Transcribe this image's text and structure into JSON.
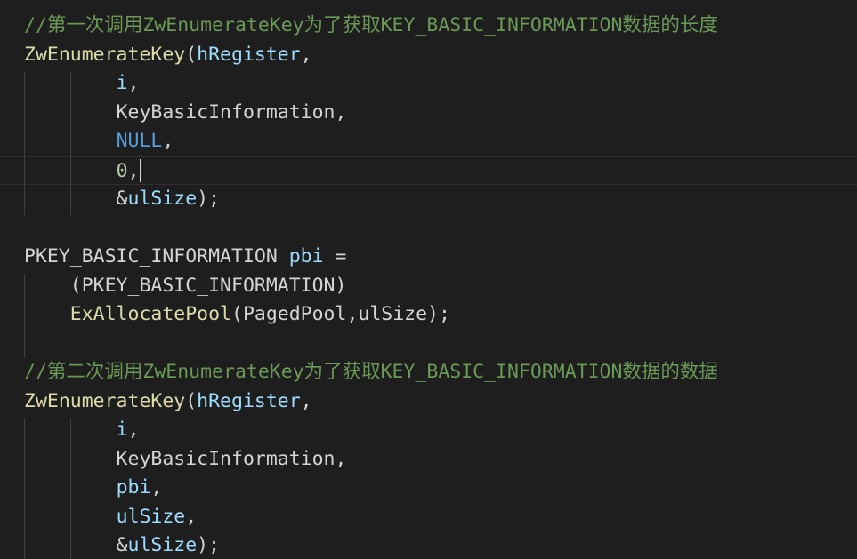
{
  "editor": {
    "colors": {
      "background": "#1e1e1e",
      "comment": "#6a9955",
      "function": "#dcdcaa",
      "variable": "#9cdcfe",
      "constant": "#569cd6",
      "default": "#d4d4d4",
      "number": "#b5cea8"
    },
    "lines": [
      [
        {
          "t": "comment",
          "v": "//第一次调用ZwEnumerateKey为了获取KEY_BASIC_INFORMATION数据的长度"
        }
      ],
      [
        {
          "t": "func",
          "v": "ZwEnumerateKey"
        },
        {
          "t": "plain",
          "v": "("
        },
        {
          "t": "var",
          "v": "hRegister"
        },
        {
          "t": "plain",
          "v": ","
        }
      ],
      [
        {
          "t": "plain",
          "v": "        "
        },
        {
          "t": "var",
          "v": "i"
        },
        {
          "t": "plain",
          "v": ","
        }
      ],
      [
        {
          "t": "plain",
          "v": "        KeyBasicInformation,"
        }
      ],
      [
        {
          "t": "plain",
          "v": "        "
        },
        {
          "t": "const",
          "v": "NULL"
        },
        {
          "t": "plain",
          "v": ","
        }
      ],
      [
        {
          "t": "plain",
          "v": "        "
        },
        {
          "t": "num",
          "v": "0"
        },
        {
          "t": "plain",
          "v": ","
        }
      ],
      [
        {
          "t": "plain",
          "v": "        &"
        },
        {
          "t": "var",
          "v": "ulSize"
        },
        {
          "t": "plain",
          "v": ");"
        }
      ],
      [],
      [
        {
          "t": "plain",
          "v": "PKEY_BASIC_INFORMATION "
        },
        {
          "t": "var",
          "v": "pbi"
        },
        {
          "t": "plain",
          "v": " ="
        }
      ],
      [
        {
          "t": "plain",
          "v": "    (PKEY_BASIC_INFORMATION)"
        }
      ],
      [
        {
          "t": "plain",
          "v": "    "
        },
        {
          "t": "func",
          "v": "ExAllocatePool"
        },
        {
          "t": "plain",
          "v": "(PagedPool,ulSize);"
        }
      ],
      [],
      [
        {
          "t": "comment",
          "v": "//第二次调用ZwEnumerateKey为了获取KEY_BASIC_INFORMATION数据的数据"
        }
      ],
      [
        {
          "t": "func",
          "v": "ZwEnumerateKey"
        },
        {
          "t": "plain",
          "v": "("
        },
        {
          "t": "var",
          "v": "hRegister"
        },
        {
          "t": "plain",
          "v": ","
        }
      ],
      [
        {
          "t": "plain",
          "v": "        "
        },
        {
          "t": "var",
          "v": "i"
        },
        {
          "t": "plain",
          "v": ","
        }
      ],
      [
        {
          "t": "plain",
          "v": "        KeyBasicInformation,"
        }
      ],
      [
        {
          "t": "plain",
          "v": "        "
        },
        {
          "t": "var",
          "v": "pbi"
        },
        {
          "t": "plain",
          "v": ","
        }
      ],
      [
        {
          "t": "plain",
          "v": "        "
        },
        {
          "t": "var",
          "v": "ulSize"
        },
        {
          "t": "plain",
          "v": ","
        }
      ],
      [
        {
          "t": "plain",
          "v": "        &"
        },
        {
          "t": "var",
          "v": "ulSize"
        },
        {
          "t": "plain",
          "v": ");"
        }
      ]
    ],
    "current_line": 5
  }
}
